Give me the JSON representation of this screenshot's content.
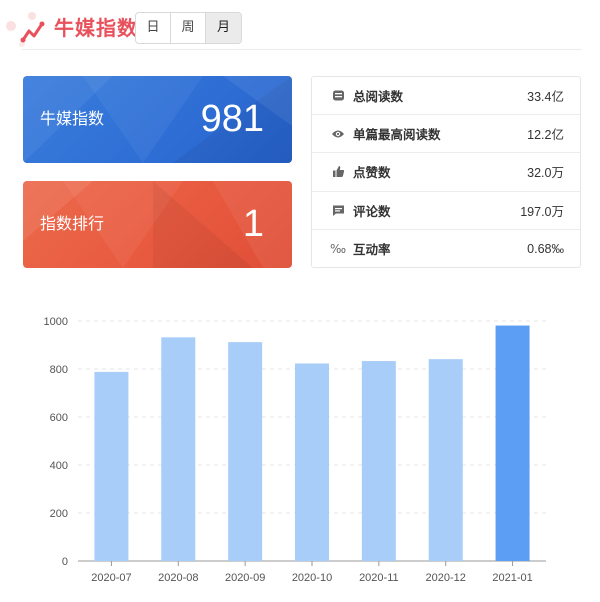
{
  "header": {
    "title": "牛媒指数",
    "logo_icon": "trend-line-icon",
    "periods": [
      "日",
      "周",
      "月"
    ],
    "active_period": "月"
  },
  "cards": {
    "index": {
      "label": "牛媒指数",
      "value": "981",
      "color": "#2f6fd5"
    },
    "rank": {
      "label": "指数排行",
      "value": "1",
      "color": "#e85a40"
    }
  },
  "stats": [
    {
      "icon": "book-icon",
      "label": "总阅读数",
      "value": "33.4亿"
    },
    {
      "icon": "eye-icon",
      "label": "单篇最高阅读数",
      "value": "12.2亿"
    },
    {
      "icon": "thumbs-up-icon",
      "label": "点赞数",
      "value": "32.0万"
    },
    {
      "icon": "comment-icon",
      "label": "评论数",
      "value": "197.0万"
    },
    {
      "icon": "permille-icon",
      "label": "互动率",
      "value": "0.68‰"
    }
  ],
  "chart_data": {
    "type": "bar",
    "categories": [
      "2020-07",
      "2020-08",
      "2020-09",
      "2020-10",
      "2020-11",
      "2020-12",
      "2021-01"
    ],
    "values": [
      788,
      932,
      912,
      823,
      833,
      841,
      981
    ],
    "highlight_index": 6,
    "ylim": [
      0,
      1000
    ],
    "yticks": [
      0,
      200,
      400,
      600,
      800,
      1000
    ],
    "grid": true,
    "colors": {
      "bar": "#a8cdf8",
      "highlight": "#5b9ef4",
      "grid": "#e4e4e4"
    }
  }
}
